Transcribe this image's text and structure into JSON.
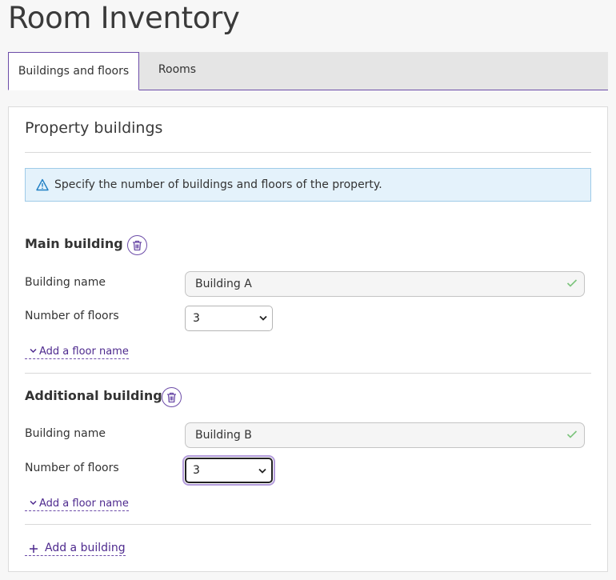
{
  "page": {
    "title": "Room Inventory"
  },
  "tabs": [
    {
      "label": "Buildings and floors",
      "active": true
    },
    {
      "label": "Rooms",
      "active": false
    }
  ],
  "section": {
    "title": "Property buildings",
    "alert": {
      "icon": "warning-triangle-icon",
      "text": "Specify the number of buildings and floors of the property."
    }
  },
  "buildings": [
    {
      "heading": "Main building",
      "name_label": "Building name",
      "name_value": "Building A",
      "floors_label": "Number of floors",
      "floors_value": "3",
      "add_floor_label": "Add a floor name"
    },
    {
      "heading": "Additional building",
      "name_label": "Building name",
      "name_value": "Building B",
      "floors_label": "Number of floors",
      "floors_value": "3",
      "add_floor_label": "Add a floor name"
    }
  ],
  "add_building_label": "Add a building",
  "colors": {
    "accent": "#6c4ca8",
    "link": "#4e2a8e",
    "info_bg": "#e4f2fb",
    "valid": "#7cc47c"
  }
}
